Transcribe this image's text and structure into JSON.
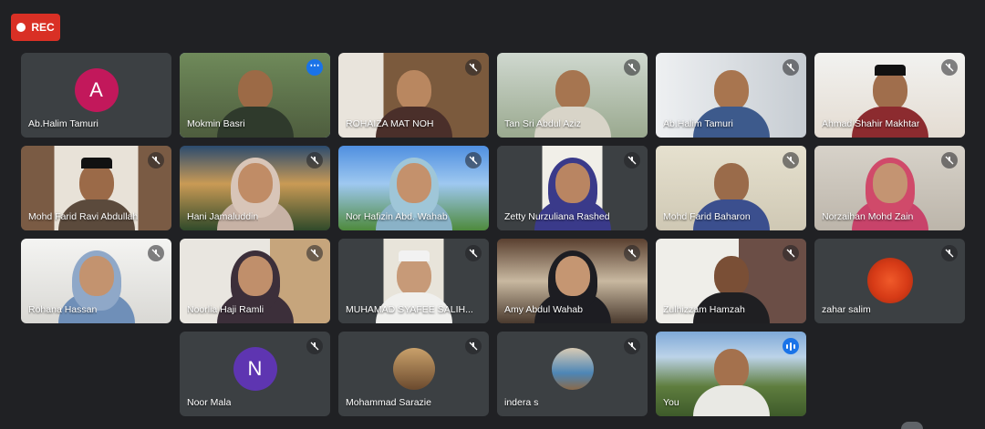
{
  "recording": {
    "label": "REC",
    "color": "#d93025"
  },
  "participants": [
    {
      "name": "Ab.Halim Tamuri",
      "avatar_letter": "A",
      "avatar_color": "#c2185b",
      "status": "none"
    },
    {
      "name": "Mokmin Basri",
      "status": "more-options",
      "highlighted": true
    },
    {
      "name": "ROHAIZA MAT NOH",
      "status": "muted"
    },
    {
      "name": "Tan Sri Abdul Aziz",
      "status": "muted"
    },
    {
      "name": "Ab.Halim Tamuri",
      "status": "muted"
    },
    {
      "name": "Ahmad Shahir Makhtar",
      "status": "muted"
    },
    {
      "name": "Mohd Farid Ravi Abdullah",
      "status": "muted"
    },
    {
      "name": "Hani Jamaluddin",
      "status": "muted"
    },
    {
      "name": "Nor Hafizin Abd. Wahab",
      "status": "muted"
    },
    {
      "name": "Zetty Nurzuliana Rashed",
      "status": "muted"
    },
    {
      "name": "Mohd Farid Baharon",
      "status": "muted"
    },
    {
      "name": "Norzaihan Mohd Zain",
      "status": "muted"
    },
    {
      "name": "Rohana Hassan",
      "status": "muted"
    },
    {
      "name": "Noorlia Haji Ramli",
      "status": "muted"
    },
    {
      "name": "MUHAMAD SYAFEE SALIH...",
      "status": "muted"
    },
    {
      "name": "Amy Abdul Wahab",
      "status": "muted"
    },
    {
      "name": "Zulhizzam Hamzah",
      "status": "muted"
    },
    {
      "name": "zahar salim",
      "status": "muted"
    },
    {
      "name": "Noor Mala",
      "avatar_letter": "N",
      "avatar_color": "#5e35b1",
      "status": "muted"
    },
    {
      "name": "Mohammad Sarazie",
      "status": "muted"
    },
    {
      "name": "indera s",
      "status": "muted"
    },
    {
      "name": "You",
      "status": "speaking"
    }
  ]
}
